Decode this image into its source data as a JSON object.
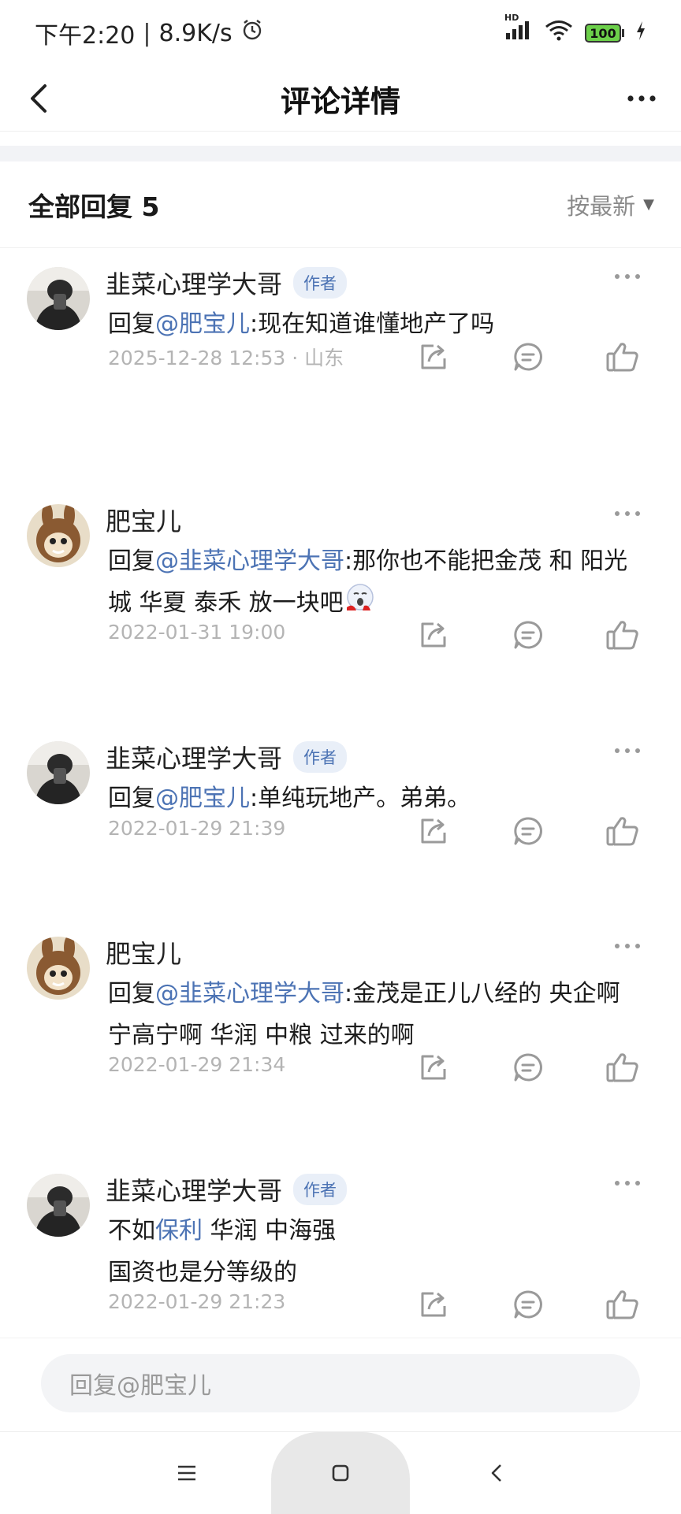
{
  "status_bar": {
    "time": "下午2:20",
    "speed": "8.9K/s",
    "battery": "100",
    "hd": "HD"
  },
  "nav": {
    "title": "评论详情"
  },
  "section": {
    "title": "全部回复 5",
    "sort_label": "按最新"
  },
  "comments": [
    {
      "name": "韭菜心理学大哥",
      "badge": "作者",
      "prefix": "回复",
      "mention": "@肥宝儿",
      "text": ":现在知道谁懂地产了吗",
      "time": "2025-12-28 12:53",
      "location": "山东"
    },
    {
      "name": "肥宝儿",
      "prefix": "回复",
      "mention": "@韭菜心理学大哥",
      "text": ":那你也不能把金茂 和 阳光城 华夏 泰禾 放一块吧",
      "time": "2022-01-31 19:00"
    },
    {
      "name": "韭菜心理学大哥",
      "badge": "作者",
      "prefix": "回复",
      "mention": "@肥宝儿",
      "text": ":单纯玩地产。弟弟。",
      "time": "2022-01-29 21:39"
    },
    {
      "name": "肥宝儿",
      "prefix": "回复",
      "mention": "@韭菜心理学大哥",
      "text": ":金茂是正儿八经的 央企啊 宁高宁啊 华润 中粮 过来的啊",
      "time": "2022-01-29 21:34"
    },
    {
      "name": "韭菜心理学大哥",
      "badge": "作者",
      "prefix": "不如",
      "mention": "保利",
      "text": " 华润 中海强",
      "line2": "国资也是分等级的",
      "time": "2022-01-29 21:23"
    }
  ],
  "reply_box": {
    "placeholder": "回复@肥宝儿"
  },
  "icons": [
    "back-arrow-icon",
    "more-dots-icon",
    "alarm-icon",
    "signal-icon",
    "wifi-icon",
    "battery-icon",
    "charging-icon",
    "share-icon",
    "comment-icon",
    "like-icon",
    "menu-icon",
    "home-icon",
    "system-back-icon",
    "caret-down-icon"
  ],
  "colors": {
    "mention": "#4c73b4",
    "badge_bg": "#e9eff8",
    "meta": "#b4b4b4"
  }
}
